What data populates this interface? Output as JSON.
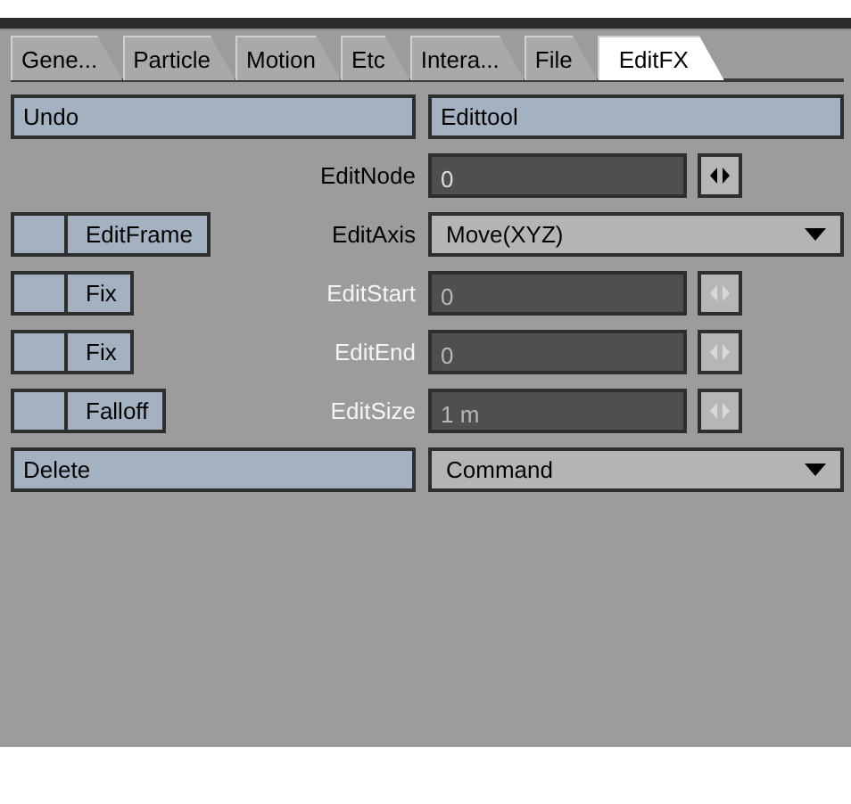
{
  "tabs": [
    {
      "label": "Gene...",
      "selected": false
    },
    {
      "label": "Particle",
      "selected": false
    },
    {
      "label": "Motion",
      "selected": false
    },
    {
      "label": "Etc",
      "selected": false
    },
    {
      "label": "Intera...",
      "selected": false
    },
    {
      "label": "File",
      "selected": false
    },
    {
      "label": "EditFX",
      "selected": true
    }
  ],
  "rows": [
    {
      "left": {
        "kind": "button",
        "label": "Undo"
      },
      "control": {
        "kind": "button",
        "value": "Edittool"
      }
    },
    {
      "label": "EditNode",
      "control": {
        "kind": "number",
        "value": "0",
        "disabled": false
      }
    },
    {
      "left": {
        "kind": "toggle",
        "label": "EditFrame",
        "checked": false
      },
      "label": "EditAxis",
      "control": {
        "kind": "select",
        "value": "Move(XYZ)"
      }
    },
    {
      "left": {
        "kind": "toggle",
        "label": "Fix",
        "checked": false
      },
      "label": "EditStart",
      "control": {
        "kind": "number",
        "value": "0",
        "disabled": true
      }
    },
    {
      "left": {
        "kind": "toggle",
        "label": "Fix",
        "checked": false
      },
      "label": "EditEnd",
      "control": {
        "kind": "number",
        "value": "0",
        "disabled": true
      }
    },
    {
      "left": {
        "kind": "toggle",
        "label": "Falloff",
        "checked": false
      },
      "label": "EditSize",
      "control": {
        "kind": "number",
        "value": "1 m",
        "disabled": true
      }
    },
    {
      "left": {
        "kind": "button",
        "label": "Delete"
      },
      "control": {
        "kind": "select",
        "value": "Command"
      }
    }
  ]
}
